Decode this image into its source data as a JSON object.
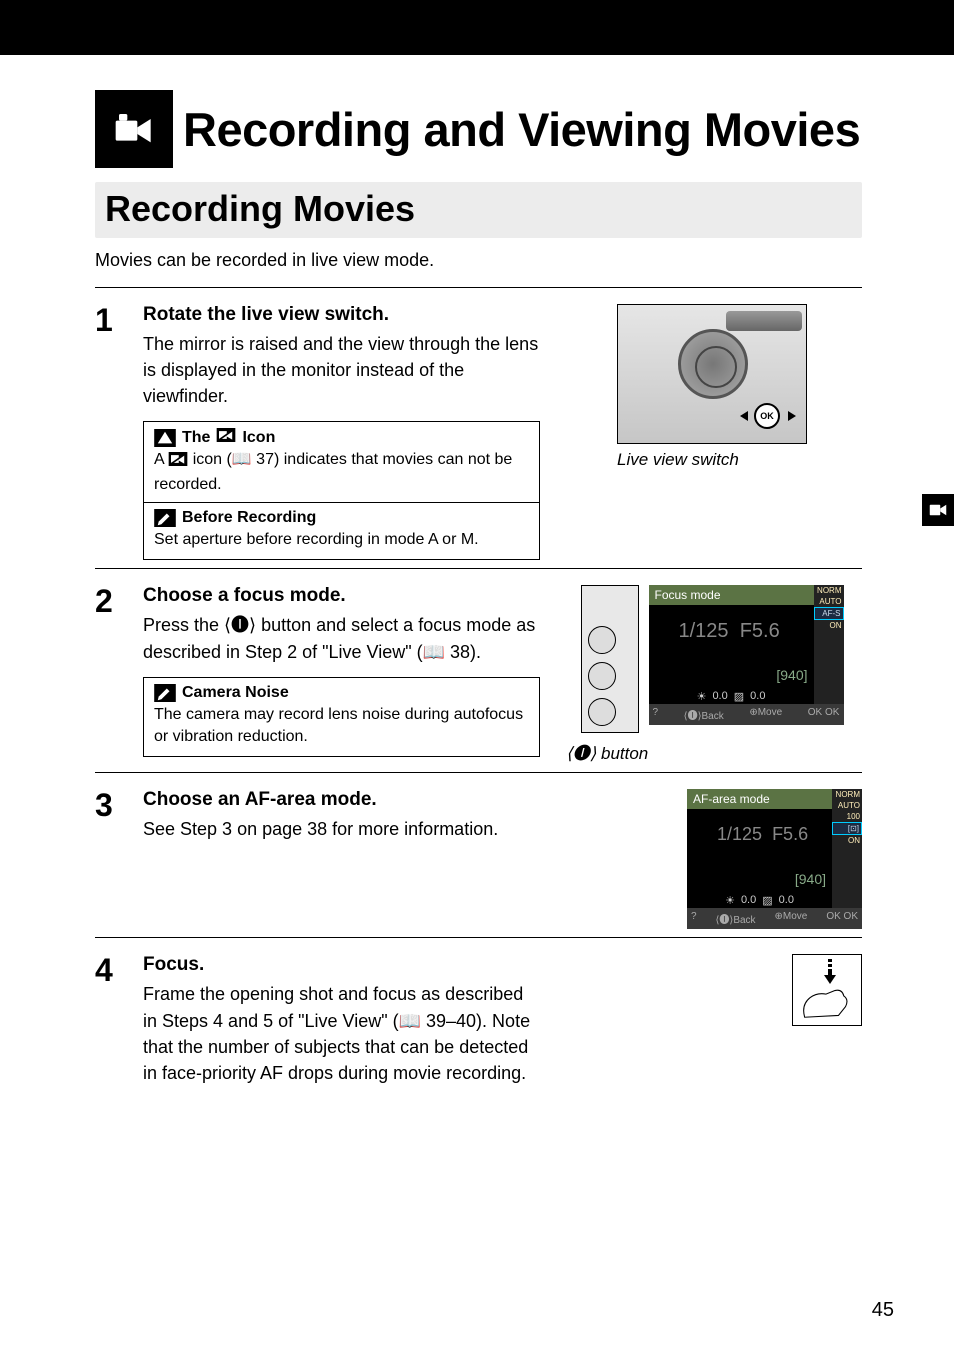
{
  "chapter": {
    "title": "Recording and Viewing Movies"
  },
  "section": {
    "title": "Recording Movies"
  },
  "intro": "Movies can be recorded in live view mode.",
  "steps": [
    {
      "num": "1",
      "title": "Rotate the live view switch.",
      "text": "The mirror is raised and the view through the lens is displayed in the monitor instead of the viewfinder.",
      "caption": "Live view switch",
      "notes": [
        {
          "icon": "alert",
          "head_before": "The ",
          "head_after": " Icon",
          "body_before": "A ",
          "body_mid": " icon (📖 37) indicates that movies can not be recorded."
        },
        {
          "icon": "pencil",
          "head": "Before Recording",
          "body": "Set aperture before recording in mode A or M."
        }
      ]
    },
    {
      "num": "2",
      "title": "Choose a focus mode.",
      "text": "Press the ⟨🅘⟩ button and select a focus mode as described in Step 2 of \"Live View\" (📖 38).",
      "caption": "⟨🅘⟩ button",
      "notes": [
        {
          "icon": "pencil",
          "head": "Camera Noise",
          "body": "The camera may record lens noise during autofocus or vibration reduction."
        }
      ],
      "screen": {
        "title": "Focus mode",
        "shutter": "1/125",
        "fstop": "F5.6",
        "shots": "[940]",
        "bar": [
          "0.0",
          "0.0"
        ],
        "side": [
          "NORM",
          "AUTO",
          "AF-S",
          "ON"
        ],
        "footer": [
          "?",
          "⟨🅘⟩Back",
          "⊕Move",
          "OK OK"
        ]
      }
    },
    {
      "num": "3",
      "title": "Choose an AF-area mode.",
      "text": "See Step 3 on page 38 for more information.",
      "screen": {
        "title": "AF-area mode",
        "shutter": "1/125",
        "fstop": "F5.6",
        "shots": "[940]",
        "bar": [
          "0.0",
          "0.0"
        ],
        "side": [
          "NORM",
          "AUTO",
          "100",
          "[⊡]",
          "ON"
        ],
        "footer": [
          "?",
          "⟨🅘⟩Back",
          "⊕Move",
          "OK OK"
        ]
      }
    },
    {
      "num": "4",
      "title": "Focus.",
      "text": "Frame the opening shot and focus as described in Steps 4 and 5 of \"Live View\" (📖 39–40).  Note that the number of subjects that can be detected in face-priority AF drops during movie recording."
    }
  ],
  "page_number": "45"
}
